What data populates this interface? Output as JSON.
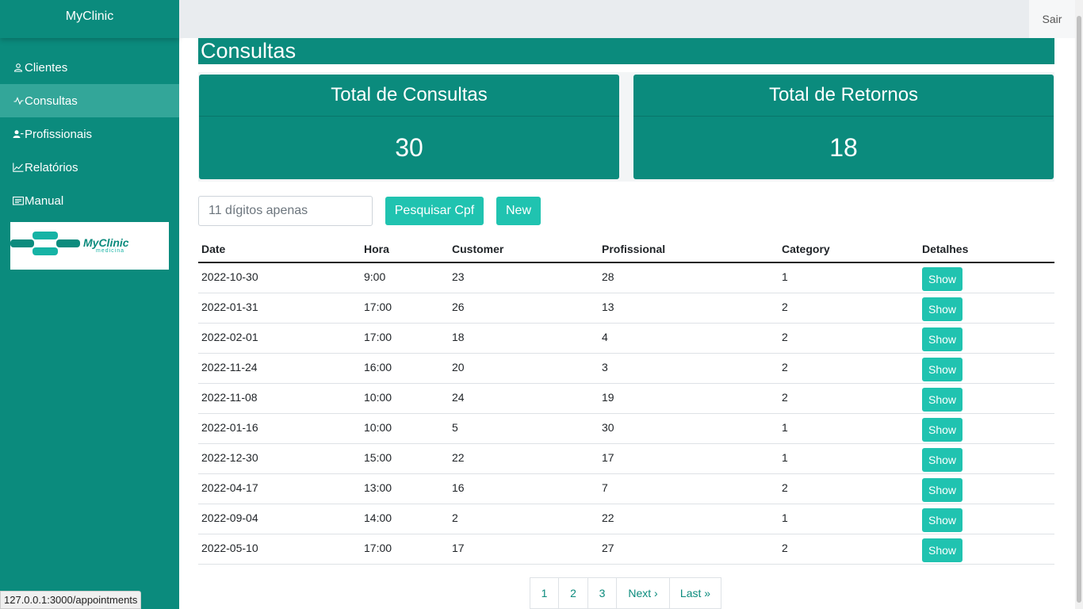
{
  "brand": "MyClinic",
  "topbar": {
    "logout_label": "Sair"
  },
  "sidebar": {
    "items": [
      {
        "label": "Clientes",
        "icon": "user-icon"
      },
      {
        "label": "Consultas",
        "icon": "activity-icon"
      },
      {
        "label": "Profissionais",
        "icon": "users-icon"
      },
      {
        "label": "Relatórios",
        "icon": "graph-up-icon"
      },
      {
        "label": "Manual",
        "icon": "card-text-icon"
      }
    ],
    "active_index": 1,
    "logo": {
      "name": "MyClinic",
      "subtitle": "medicina"
    }
  },
  "page": {
    "title": "Consultas"
  },
  "cards": [
    {
      "title": "Total de Consultas",
      "value": "30"
    },
    {
      "title": "Total de Retornos",
      "value": "18"
    }
  ],
  "search": {
    "placeholder": "11 dígitos apenas",
    "value": "",
    "button_label": "Pesquisar Cpf",
    "new_label": "New"
  },
  "table": {
    "headers": [
      "Date",
      "Hora",
      "Customer",
      "Profissional",
      "Category",
      "Detalhes"
    ],
    "rows": [
      [
        "2022-10-30",
        "9:00",
        "23",
        "28",
        "1"
      ],
      [
        "2022-01-31",
        "17:00",
        "26",
        "13",
        "2"
      ],
      [
        "2022-02-01",
        "17:00",
        "18",
        "4",
        "2"
      ],
      [
        "2022-11-24",
        "16:00",
        "20",
        "3",
        "2"
      ],
      [
        "2022-11-08",
        "10:00",
        "24",
        "19",
        "2"
      ],
      [
        "2022-01-16",
        "10:00",
        "5",
        "30",
        "1"
      ],
      [
        "2022-12-30",
        "15:00",
        "22",
        "17",
        "1"
      ],
      [
        "2022-04-17",
        "13:00",
        "16",
        "7",
        "2"
      ],
      [
        "2022-09-04",
        "14:00",
        "2",
        "22",
        "1"
      ],
      [
        "2022-05-10",
        "17:00",
        "17",
        "27",
        "2"
      ]
    ],
    "action_label": "Show"
  },
  "pagination": [
    "1",
    "2",
    "3",
    "Next ›",
    "Last »"
  ],
  "status_url": "127.0.0.1:3000/appointments",
  "colors": {
    "primary": "#0b8b7d",
    "accent": "#20c3b0",
    "active": "#33a699"
  }
}
